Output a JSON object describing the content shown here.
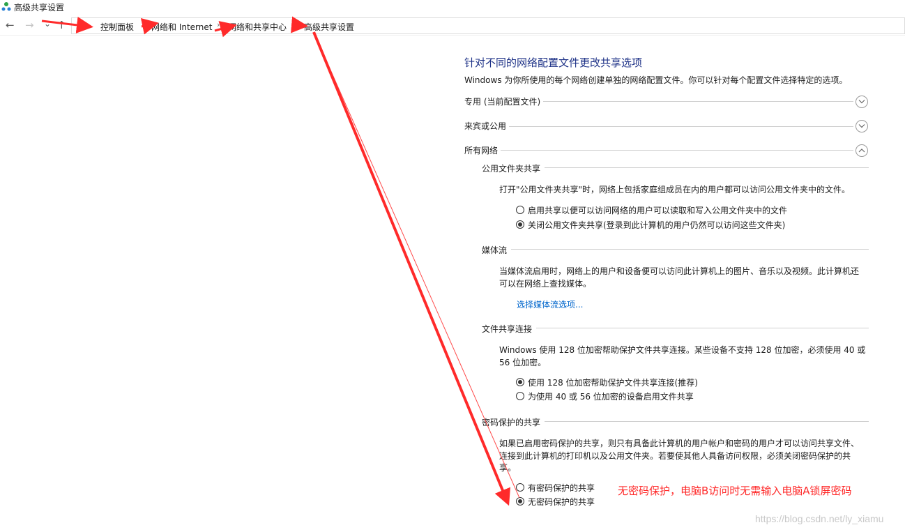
{
  "window": {
    "title": "高级共享设置"
  },
  "nav": {
    "back_icon": "←",
    "forward_icon": "→",
    "dropdown_icon": "⌄",
    "up_icon": "↑"
  },
  "breadcrumb": {
    "separator": "›",
    "items": [
      "控制面板",
      "网络和 Internet",
      "网络和共享中心",
      "高级共享设置"
    ]
  },
  "page": {
    "heading": "针对不同的网络配置文件更改共享选项",
    "description": "Windows 为你所使用的每个网络创建单独的网络配置文件。你可以针对每个配置文件选择特定的选项。"
  },
  "profiles": [
    {
      "label": "专用 (当前配置文件)",
      "state": "collapsed"
    },
    {
      "label": "来宾或公用",
      "state": "collapsed"
    },
    {
      "label": "所有网络",
      "state": "expanded"
    }
  ],
  "all_networks": {
    "public_folder": {
      "title": "公用文件夹共享",
      "text": "打开\"公用文件夹共享\"时，网络上包括家庭组成员在内的用户都可以访问公用文件夹中的文件。",
      "options": [
        {
          "label": "启用共享以便可以访问网络的用户可以读取和写入公用文件夹中的文件",
          "checked": false
        },
        {
          "label": "关闭公用文件夹共享(登录到此计算机的用户仍然可以访问这些文件夹)",
          "checked": true
        }
      ]
    },
    "media": {
      "title": "媒体流",
      "text_line1": "当媒体流启用时，网络上的用户和设备便可以访问此计算机上的图片、音乐以及视频。此计算机还",
      "text_line2": "可以在网络上查找媒体。",
      "link": "选择媒体流选项..."
    },
    "file_sharing": {
      "title": "文件共享连接",
      "text_line1": "Windows 使用 128 位加密帮助保护文件共享连接。某些设备不支持 128 位加密，必须使用 40 或",
      "text_line2": "56 位加密。",
      "options": [
        {
          "label": "使用 128 位加密帮助保护文件共享连接(推荐)",
          "checked": true
        },
        {
          "label": "为使用 40 或 56 位加密的设备启用文件共享",
          "checked": false
        }
      ]
    },
    "password": {
      "title": "密码保护的共享",
      "text_line1": "如果已启用密码保护的共享，则只有具备此计算机的用户帐户和密码的用户才可以访问共享文件、",
      "text_line2": "连接到此计算机的打印机以及公用文件夹。若要使其他人具备访问权限，必须关闭密码保护的共",
      "text_line3": "享。",
      "options": [
        {
          "label": "有密码保护的共享",
          "checked": false
        },
        {
          "label": "无密码保护的共享",
          "checked": true
        }
      ]
    }
  },
  "annotation": {
    "text": "无密码保护，电脑B访问时无需输入电脑A锁屏密码",
    "color": "#ff2a2a"
  },
  "watermark": "https://blog.csdn.net/ly_xiamu"
}
